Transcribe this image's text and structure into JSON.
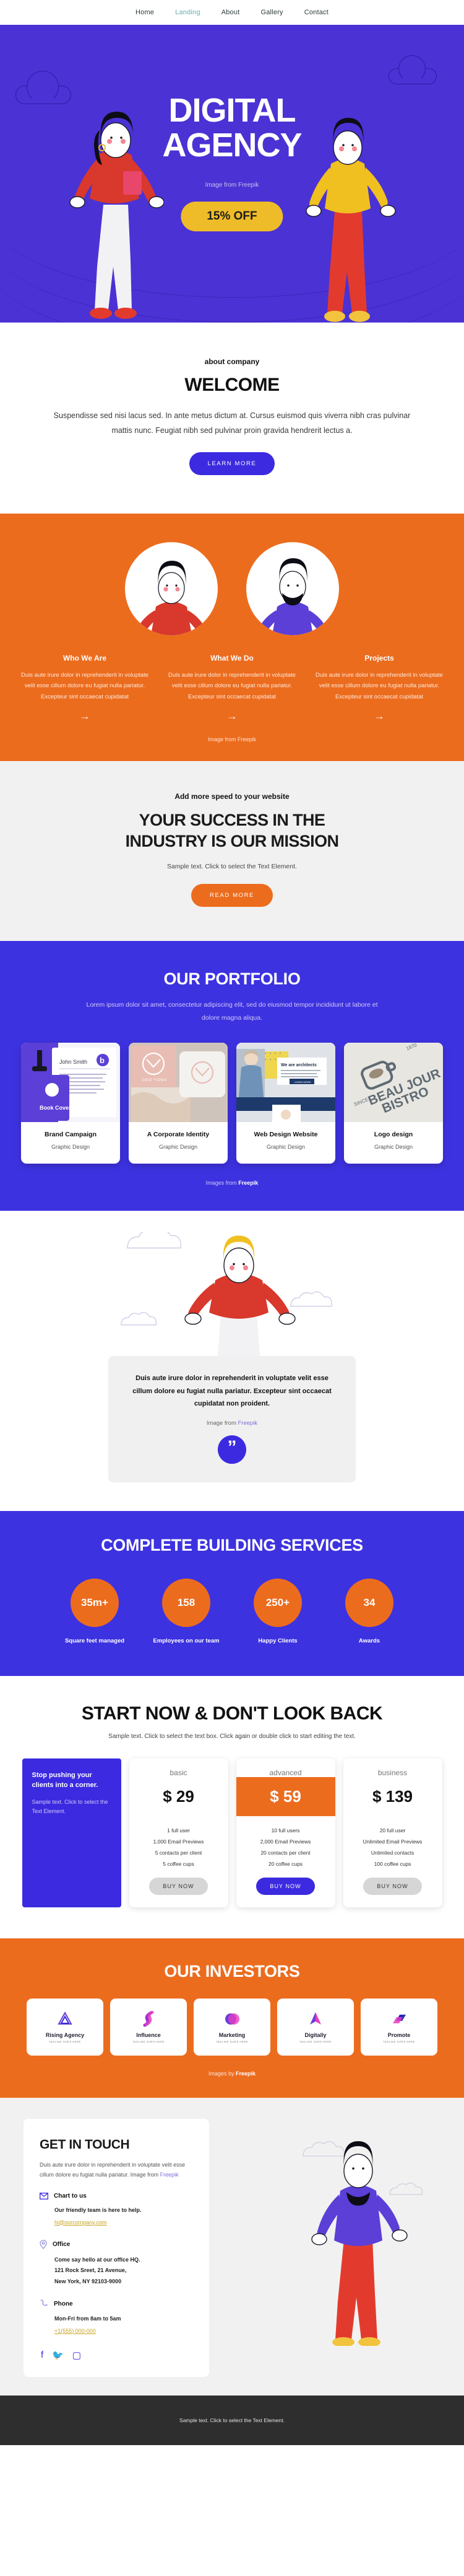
{
  "nav": {
    "items": [
      {
        "label": "Home",
        "active": false
      },
      {
        "label": "Landing",
        "active": true
      },
      {
        "label": "About",
        "active": false
      },
      {
        "label": "Gallery",
        "active": false
      },
      {
        "label": "Contact",
        "active": false
      }
    ],
    "active_color": "#63b0ac"
  },
  "hero": {
    "title_line1": "DIGITAL",
    "title_line2": "AGENCY",
    "credit": "Image from Freepik",
    "offer_label": "15% OFF",
    "bg_color": "#4b32d4",
    "offer_color": "#eebc28"
  },
  "welcome": {
    "eyebrow": "about company",
    "title": "WELCOME",
    "body": "Suspendisse sed nisi lacus sed. In ante metus dictum at. Cursus euismod quis viverra nibh cras pulvinar mattis nunc. Feugiat nibh sed pulvinar proin gravida hendrerit lectus a.",
    "cta": "LEARN MORE"
  },
  "features": {
    "bg_color": "#ec6c1e",
    "credit": "Image from Freepik",
    "columns": [
      {
        "title": "Who We Are",
        "body": "Duis aute irure dolor in reprehenderit in voluptate velit esse cillum dolore eu fugiat nulla pariatur. Excepteur sint occaecat cupidatat",
        "arrow": "→"
      },
      {
        "title": "What We Do",
        "body": "Duis aute irure dolor in reprehenderit in voluptate velit esse cillum dolore eu fugiat nulla pariatur. Excepteur sint occaecat cupidatat",
        "arrow": "→"
      },
      {
        "title": "Projects",
        "body": "Duis aute irure dolor in reprehenderit in voluptate velit esse cillum dolore eu fugiat nulla pariatur. Excepteur sint occaecat cupidatat",
        "arrow": "→"
      }
    ]
  },
  "mission": {
    "eyebrow": "Add more speed to your website",
    "title_line1": "YOUR SUCCESS IN THE",
    "title_line2": "INDUSTRY IS OUR MISSION",
    "sub": "Sample text. Click to select the Text Element.",
    "cta": "READ MORE"
  },
  "portfolio": {
    "title": "OUR PORTFOLIO",
    "sub": "Lorem ipsum dolor sit amet, consectetur adipiscing elit, sed do eiusmod tempor incididunt ut labore et dolore magna aliqua.",
    "credit_prefix": "Images from ",
    "credit_source": "Freepik",
    "cards": [
      {
        "title": "Brand Campaign",
        "category": "Graphic Design",
        "thumb_caption": "Book Cover",
        "thumb_name": "John Smith"
      },
      {
        "title": "A Corporate Identity",
        "category": "Graphic Design",
        "thumb_caption": "DEO YONO",
        "thumb_name": ""
      },
      {
        "title": "Web Design Website",
        "category": "Graphic Design",
        "thumb_caption": "We are architects",
        "thumb_name": "LEARN MORE"
      },
      {
        "title": "Logo design",
        "category": "Graphic Design",
        "thumb_caption": "BEAU JOUR BISTRO",
        "thumb_name": "SINCE 1970"
      }
    ]
  },
  "quote": {
    "text": "Duis aute irure dolor in reprehenderit in voluptate velit esse cillum dolore eu fugiat nulla pariatur. Excepteur sint occaecat cupidatat non proident.",
    "credit_prefix": "Image from ",
    "credit_source": "Freepik",
    "mark": "”"
  },
  "stats": {
    "title": "COMPLETE BUILDING SERVICES",
    "bg_color": "#3d32e0",
    "bubble_color": "#ec6c1e",
    "items": [
      {
        "value": "35m+",
        "label": "Square feet managed"
      },
      {
        "value": "158",
        "label": "Employees on our team"
      },
      {
        "value": "250+",
        "label": "Happy Clients"
      },
      {
        "value": "34",
        "label": "Awards"
      }
    ]
  },
  "pricing": {
    "title": "START NOW & DON'T LOOK BACK",
    "sub": "Sample text. Click to select the text box. Click again or double click to start editing the text.",
    "promo": {
      "title": "Stop pushing your clients into a corner.",
      "body": "Sample text. Click to select the Text Element."
    },
    "plans": [
      {
        "name": "basic",
        "price": "$ 29",
        "highlight": false,
        "features": [
          "1 full user",
          "1,000 Email Previews",
          "5 contacts per client",
          "5 coffee cups"
        ],
        "cta": "BUY NOW",
        "cta_primary": false
      },
      {
        "name": "advanced",
        "price": "$ 59",
        "highlight": true,
        "features": [
          "10 full users",
          "2,000 Email Previews",
          "20 contacts per client",
          "20 coffee cups"
        ],
        "cta": "BUY NOW",
        "cta_primary": true
      },
      {
        "name": "business",
        "price": "$ 139",
        "highlight": false,
        "features": [
          "20 full user",
          "Unlimited Email Previews",
          "Unlimited contacts",
          "100 coffee cups"
        ],
        "cta": "BUY NOW",
        "cta_primary": false
      }
    ]
  },
  "investors": {
    "title": "OUR INVESTORS",
    "credit_prefix": "Images by ",
    "credit_source": "Freepik",
    "items": [
      {
        "name": "Rising Agency",
        "tagline": "TAGLINE GOES HERE"
      },
      {
        "name": "Influence",
        "tagline": "TAGLINE GOES HERE"
      },
      {
        "name": "Marketing",
        "tagline": "TAGLINE GOES HERE"
      },
      {
        "name": "Digitally",
        "tagline": "TAGLINE GOES HERE"
      },
      {
        "name": "Promote",
        "tagline": "TAGLINE GOES HERE"
      }
    ]
  },
  "contact": {
    "title": "GET IN TOUCH",
    "intro_prefix": "Duis aute irure dolor in reprehenderit in voluptate velit esse cillum dolore eu fugiat nulla pariatur. Image from ",
    "intro_source": "Freepik",
    "blocks": [
      {
        "icon": "mail-icon",
        "title": "Chart to us",
        "line1": "Our friendly team is here to help.",
        "link": "hi@ourcompany.com"
      },
      {
        "icon": "location-pin-icon",
        "title": "Office",
        "line1": "Come say hello at our office HQ.",
        "line2": "121 Rock Sreet, 21 Avenue,",
        "line3": "New York, NY 92103-9000"
      },
      {
        "icon": "phone-icon",
        "title": "Phone",
        "line1": "Mon-Fri from 8am to 5am",
        "link": "+1(555) 000-000"
      }
    ],
    "socials": [
      "facebook-icon",
      "twitter-icon",
      "instagram-icon"
    ]
  },
  "footer": {
    "text": "Sample text. Click to select the Text Element.",
    "bg_color": "#2e2e2e"
  }
}
